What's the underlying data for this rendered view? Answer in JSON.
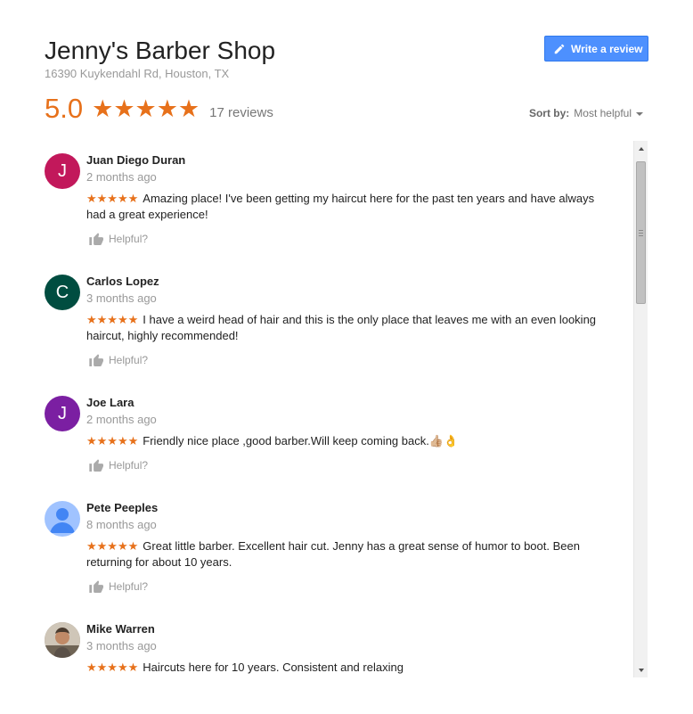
{
  "business": {
    "name": "Jenny's Barber Shop",
    "address": "16390 Kuykendahl Rd, Houston, TX"
  },
  "write_review_label": "Write a review",
  "summary": {
    "rating": "5.0",
    "stars": "★★★★★",
    "count_label": "17 reviews"
  },
  "sort": {
    "label": "Sort by:",
    "value": "Most helpful"
  },
  "colors": {
    "star": "#e7711b",
    "button": "#4d90fe"
  },
  "reviews": [
    {
      "initial": "J",
      "avatar_color": "#c2185b",
      "name": "Juan Diego Duran",
      "time": "2 months ago",
      "stars": "★★★★★",
      "text": "Amazing place! I've been getting my haircut here for the past ten years and have always had a great experience!",
      "helpful": "Helpful?"
    },
    {
      "initial": "C",
      "avatar_color": "#004d40",
      "name": "Carlos Lopez",
      "time": "3 months ago",
      "stars": "★★★★★",
      "text": "I have a weird head of hair and this is the only place that leaves me with an even looking haircut, highly recommended!",
      "helpful": "Helpful?"
    },
    {
      "initial": "J",
      "avatar_color": "#7b1fa2",
      "name": "Joe Lara",
      "time": "2 months ago",
      "stars": "★★★★★",
      "text": "Friendly nice place  ,good barber.Will keep coming back.👍🏼👌",
      "helpful": "Helpful?"
    },
    {
      "initial": "",
      "avatar_color": "#a0c3ff",
      "avatar_icon": "default-profile-icon",
      "name": "Pete Peeples",
      "time": "8 months ago",
      "stars": "★★★★★",
      "text": "Great little barber.  Excellent hair cut.  Jenny has a great sense of humor to boot.  Been returning for about 10 years.",
      "helpful": "Helpful?"
    },
    {
      "initial": "",
      "avatar_color": "#8d8172",
      "avatar_icon": "profile-photo",
      "name": "Mike Warren",
      "time": "3 months ago",
      "stars": "★★★★★",
      "text": "Haircuts here for 10 years. Consistent and relaxing",
      "helpful": "Helpful?"
    }
  ]
}
